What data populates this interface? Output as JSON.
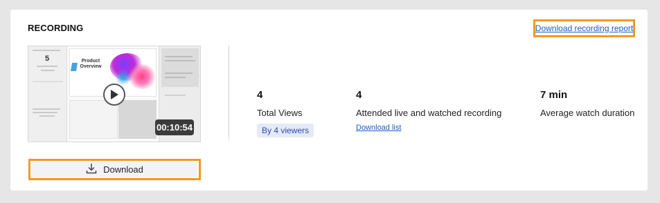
{
  "recording": {
    "section_title": "RECORDING",
    "report_link": "Download recording report",
    "thumbnail": {
      "duration": "00:10:54",
      "slide_title": "Product Overview",
      "play_icon": "play-icon"
    },
    "download_label": "Download",
    "download_icon": "download-icon"
  },
  "stats": [
    {
      "value": "4",
      "label": "Total Views",
      "badge": "By 4 viewers"
    },
    {
      "value": "4",
      "label": "Attended live and watched recording",
      "link": "Download list"
    },
    {
      "value": "7 min",
      "label": "Average watch duration"
    }
  ],
  "colors": {
    "highlight": "#f29a1f",
    "link": "#1e5bc6",
    "badge_bg": "#e6e9f6",
    "badge_text": "#2b4bb5"
  }
}
